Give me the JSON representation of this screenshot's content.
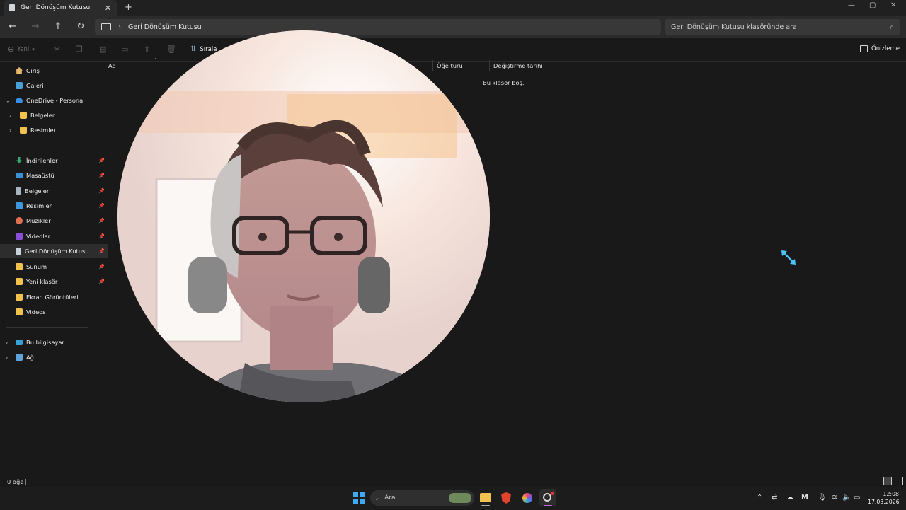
{
  "window": {
    "tab_title": "Geri Dönüşüm Kutusu",
    "tab_close": "✕",
    "new_tab": "+"
  },
  "nav": {
    "address_path": "Geri Dönüşüm Kutusu",
    "search_placeholder": "Geri Dönüşüm Kutusu klasöründe ara"
  },
  "commandbar": {
    "new_label": "Yeni",
    "sort_label": "Sırala",
    "preview_label": "Önizleme"
  },
  "sidebar": {
    "top": [
      {
        "label": "Giriş",
        "icon": "home-icon"
      },
      {
        "label": "Galeri",
        "icon": "gallery-icon"
      },
      {
        "label": "OneDrive - Personal",
        "icon": "onedrive-icon"
      },
      {
        "label": "Belgeler",
        "icon": "folder-icon"
      },
      {
        "label": "Resimler",
        "icon": "folder-icon"
      }
    ],
    "quick": [
      {
        "label": "İndirilenler",
        "icon": "downloads-icon"
      },
      {
        "label": "Masaüstü",
        "icon": "desktop-icon"
      },
      {
        "label": "Belgeler",
        "icon": "documents-icon"
      },
      {
        "label": "Resimler",
        "icon": "pictures-icon"
      },
      {
        "label": "Müzikler",
        "icon": "music-icon"
      },
      {
        "label": "Videolar",
        "icon": "videos-icon"
      },
      {
        "label": "Geri Dönüşüm Kutusu",
        "icon": "recycle-bin-icon"
      },
      {
        "label": "Sunum",
        "icon": "folder-icon"
      },
      {
        "label": "Yeni klasör",
        "icon": "folder-icon"
      },
      {
        "label": "Ekran Görüntüleri",
        "icon": "folder-icon"
      },
      {
        "label": "Videos",
        "icon": "folder-icon"
      }
    ],
    "bottom": [
      {
        "label": "Bu bilgisayar",
        "icon": "this-pc-icon"
      },
      {
        "label": "Ağ",
        "icon": "network-icon"
      }
    ]
  },
  "content": {
    "columns": [
      "Ad",
      "Öğe türü",
      "Değiştirme tarihi"
    ],
    "empty_message": "Bu klasör boş."
  },
  "status": {
    "item_count": "0 öğe"
  },
  "taskbar": {
    "search_label": "Ara",
    "time": "12:08",
    "date": "17.03.2026"
  },
  "colors": {
    "accent": "#4cc2ff",
    "folder": "#f2c14e",
    "background": "#191919"
  }
}
